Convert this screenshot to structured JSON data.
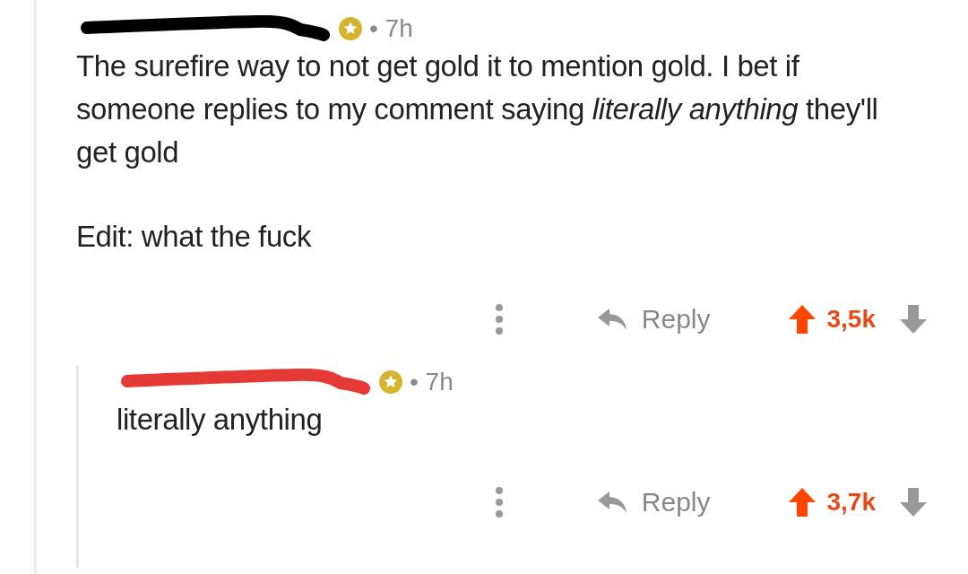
{
  "comments": [
    {
      "kind": "black",
      "gilded": true,
      "time": "• 7h",
      "body": [
        "The surefire way to not get gold it to mention gold. I bet if someone replies to my comment saying *literally anything* they'll get gold",
        "Edit: what the fuck"
      ],
      "reply_label": "Reply",
      "upvoted": true,
      "score": "3,5k",
      "children": [
        {
          "kind": "red",
          "gilded": true,
          "time": "• 7h",
          "body": [
            "literally anything"
          ],
          "reply_label": "Reply",
          "upvoted": true,
          "score": "3,7k"
        }
      ]
    }
  ]
}
